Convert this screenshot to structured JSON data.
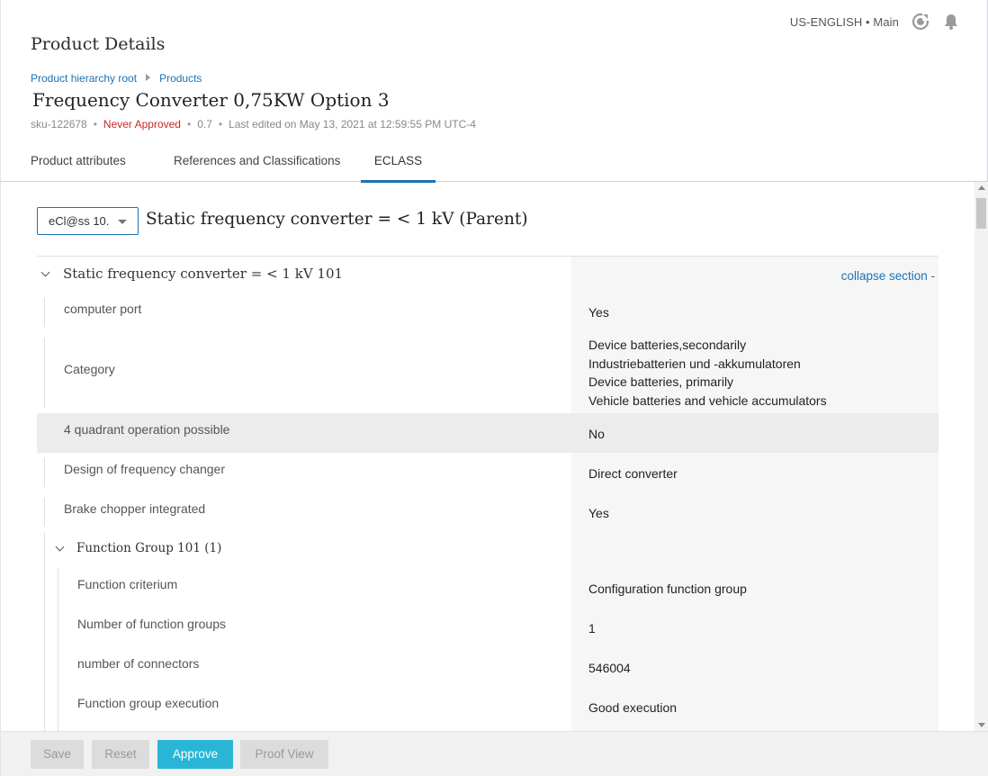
{
  "header": {
    "locale": "US-ENGLISH • Main",
    "page_title": "Product Details"
  },
  "breadcrumb": [
    "Product hierarchy root",
    "Products"
  ],
  "product": {
    "name": "Frequency Converter 0,75KW Option 3",
    "sku": "sku-122678",
    "status": "Never Approved",
    "version": "0.7",
    "last_edited": "Last edited on May 13, 2021 at 12:59:55 PM UTC-4"
  },
  "tabs": [
    {
      "label": "Product attributes",
      "active": false
    },
    {
      "label": "References and Classifications",
      "active": false
    },
    {
      "label": "ECLASS",
      "active": true
    }
  ],
  "eclass": {
    "version_select": "eCl@ss 10.",
    "class_title": "Static frequency converter = < 1 kV (Parent)",
    "section_title": "Static frequency converter = < 1 kV 101",
    "collapse_label": "collapse section -",
    "attributes": [
      {
        "label": "computer port",
        "value": "Yes"
      },
      {
        "label": "Category",
        "value": "Device batteries,secondarily\nIndustriebatterien und -akkumulatoren\nDevice batteries, primarily\nVehicle batteries and vehicle accumulators"
      },
      {
        "label": "4 quadrant operation possible",
        "value": "No"
      },
      {
        "label": "Design of frequency changer",
        "value": "Direct converter"
      },
      {
        "label": "Brake chopper integrated",
        "value": "Yes"
      }
    ],
    "group": {
      "title": "Function Group 101 (1)",
      "attributes": [
        {
          "label": "Function criterium",
          "value": "Configuration function group"
        },
        {
          "label": "Number of function groups",
          "value": "1"
        },
        {
          "label": "number of connectors",
          "value": "546004"
        },
        {
          "label": "Function group execution",
          "value": "Good execution"
        }
      ]
    }
  },
  "footer": {
    "save": "Save",
    "reset": "Reset",
    "approve": "Approve",
    "proof_view": "Proof View"
  },
  "colors": {
    "accent": "#1a73b5",
    "approve_button": "#29b6d6",
    "status_never_approved": "#c62828"
  }
}
